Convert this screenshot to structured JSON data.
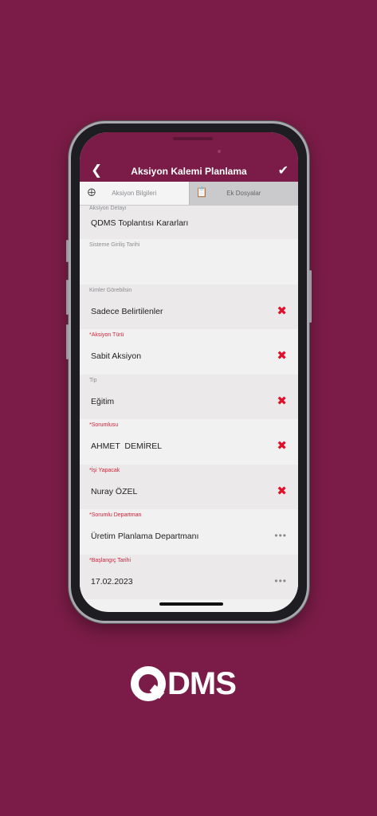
{
  "header": {
    "title": "Aksiyon Kalemi Planlama",
    "back_icon": "chevron-left-icon",
    "save_icon": "check-icon"
  },
  "tabs": [
    {
      "label": "Aksiyon Bilgileri",
      "icon": "info-circle-icon",
      "active": true
    },
    {
      "label": "Ek Dosyalar",
      "icon": "attachment-icon",
      "active": false
    }
  ],
  "fields": [
    {
      "label": "Aksiyon Detayı",
      "value": "QDMS Toplantısı Kararları",
      "required": false,
      "action": ""
    },
    {
      "label": "Sisteme Giriliş Tarihi",
      "value": "",
      "required": false,
      "action": ""
    },
    {
      "label": "Kimler Görebilsin",
      "value": "Sadece Belirtilenler",
      "required": false,
      "action": "clear"
    },
    {
      "label": "*Aksiyon Türü",
      "value": "Sabit Aksiyon",
      "required": true,
      "action": "clear"
    },
    {
      "label": "Tip",
      "value": "Eğitim",
      "required": false,
      "action": "clear"
    },
    {
      "label": "*Sorumlusu",
      "value": "AHMET  DEMİREL",
      "required": true,
      "action": "clear"
    },
    {
      "label": "*İşi Yapacak",
      "value": "Nuray ÖZEL",
      "required": true,
      "action": "clear"
    },
    {
      "label": "*Sorumlu Departman",
      "value": "Üretim Planlama Departmanı",
      "required": true,
      "action": "more"
    },
    {
      "label": "*Başlangıç Tarihi",
      "value": "17.02.2023",
      "required": true,
      "action": "more"
    }
  ],
  "brand": {
    "logo_text": "DMS",
    "logo_letter": "Q",
    "color": "#7a1c47",
    "accent_red": "#e0102a"
  }
}
